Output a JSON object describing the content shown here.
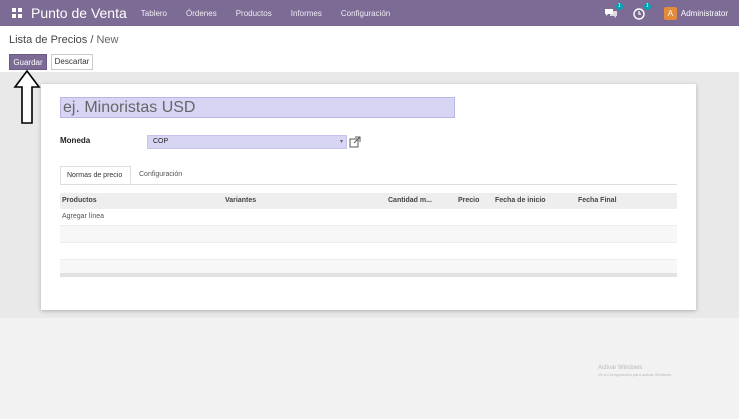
{
  "navbar": {
    "app_name": "Punto de Venta",
    "menu": [
      "Tablero",
      "Órdenes",
      "Productos",
      "Informes",
      "Configuración"
    ],
    "chat_badge": "1",
    "activity_badge": "1",
    "user_initial": "A",
    "user_name": "Administrator"
  },
  "breadcrumb": {
    "parent": "Lista de Precios",
    "separator": " / ",
    "current": "New"
  },
  "actions": {
    "save_label": "Guardar",
    "discard_label": "Descartar"
  },
  "form": {
    "name_placeholder": "ej. Minoristas USD",
    "currency_label": "Moneda",
    "currency_value": "COP",
    "tabs": [
      "Normas de precio",
      "Configuración"
    ],
    "table": {
      "columns": [
        "Productos",
        "Variantes",
        "Cantidad m...",
        "Precio",
        "Fecha de inicio",
        "Fecha Final"
      ],
      "add_line": "Agregar línea"
    }
  },
  "watermark": {
    "title": "Activar Windows",
    "subtitle": "Ve a Configuración para activar Windows."
  },
  "colors": {
    "brand": "#7b6b95",
    "field_bg": "#d7d5f4",
    "avatar": "#e48a3b",
    "badge": "#00a3b5"
  }
}
